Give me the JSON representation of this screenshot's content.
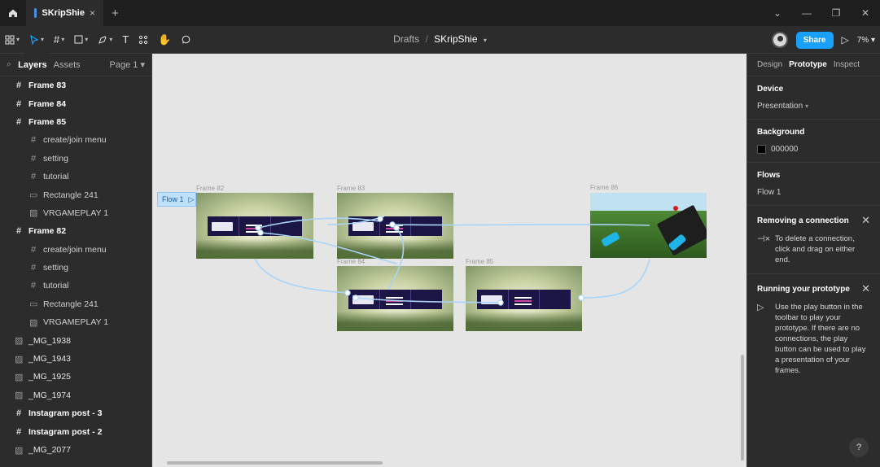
{
  "titlebar": {
    "tab_title": "SKripShie",
    "tab_close": "×",
    "new_tab": "+",
    "controls": [
      "⌄",
      "—",
      "❐",
      "✕"
    ]
  },
  "toolbar": {
    "breadcrumb": {
      "folder": "Drafts",
      "separator": "/",
      "file": "SKripShie"
    },
    "share_label": "Share",
    "zoom": "7%"
  },
  "left_panel": {
    "tabs": {
      "layers": "Layers",
      "assets": "Assets"
    },
    "page": "Page 1",
    "layers": [
      {
        "label": "Frame 83",
        "type": "frame",
        "icon": "frame-icon",
        "level": 0
      },
      {
        "label": "Frame 84",
        "type": "frame",
        "icon": "frame-icon",
        "level": 0
      },
      {
        "label": "Frame 85",
        "type": "frame",
        "icon": "frame-icon",
        "level": 0
      },
      {
        "label": "create/join menu",
        "type": "child",
        "icon": "frame-icon",
        "level": 1
      },
      {
        "label": "setting",
        "type": "child",
        "icon": "frame-icon",
        "level": 1
      },
      {
        "label": "tutorial",
        "type": "child",
        "icon": "frame-icon",
        "level": 1
      },
      {
        "label": "Rectangle 241",
        "type": "child",
        "icon": "rectangle-icon",
        "level": 1
      },
      {
        "label": "VRGAMEPLAY 1",
        "type": "child",
        "icon": "image-icon",
        "level": 1
      },
      {
        "label": "Frame 82",
        "type": "frame",
        "icon": "frame-icon",
        "level": 0
      },
      {
        "label": "create/join menu",
        "type": "child",
        "icon": "frame-icon",
        "level": 1
      },
      {
        "label": "setting",
        "type": "child",
        "icon": "frame-icon",
        "level": 1
      },
      {
        "label": "tutorial",
        "type": "child",
        "icon": "frame-icon",
        "level": 1
      },
      {
        "label": "Rectangle 241",
        "type": "child",
        "icon": "rectangle-icon",
        "level": 1
      },
      {
        "label": "VRGAMEPLAY 1",
        "type": "child",
        "icon": "image-icon",
        "level": 1
      },
      {
        "label": "_MG_1938",
        "type": "image",
        "icon": "image-icon",
        "level": 0
      },
      {
        "label": "_MG_1943",
        "type": "image",
        "icon": "image-icon",
        "level": 0
      },
      {
        "label": "_MG_1925",
        "type": "image",
        "icon": "image-icon",
        "level": 0
      },
      {
        "label": "_MG_1974",
        "type": "image",
        "icon": "image-icon",
        "level": 0
      },
      {
        "label": "Instagram post - 3",
        "type": "frame",
        "icon": "frame-icon",
        "level": 0
      },
      {
        "label": "Instagram post - 2",
        "type": "frame",
        "icon": "frame-icon",
        "level": 0
      },
      {
        "label": "_MG_2077",
        "type": "image",
        "icon": "image-icon",
        "level": 0
      }
    ]
  },
  "canvas": {
    "flow_label": "Flow 1",
    "frames": {
      "f82": "Frame 82",
      "f83": "Frame 83",
      "f84": "Frame 84",
      "f85": "Frame 85",
      "f86": "Frame 86"
    }
  },
  "right_panel": {
    "tabs": {
      "design": "Design",
      "prototype": "Prototype",
      "inspect": "Inspect"
    },
    "device": {
      "title": "Device",
      "value": "Presentation"
    },
    "background": {
      "title": "Background",
      "value": "000000"
    },
    "flows": {
      "title": "Flows",
      "value": "Flow 1"
    },
    "removing": {
      "title": "Removing a connection",
      "text": "To delete a connection, click and drag on either end."
    },
    "running": {
      "title": "Running your prototype",
      "text": "Use the play button in the toolbar to play your prototype. If there are no connections, the play button can be used to play a presentation of your frames."
    },
    "help": "?"
  },
  "colors": {
    "accent": "#18a0fb",
    "connection": "#a8d4f7",
    "canvas": "#e5e5e5",
    "panel": "#2c2c2c"
  }
}
